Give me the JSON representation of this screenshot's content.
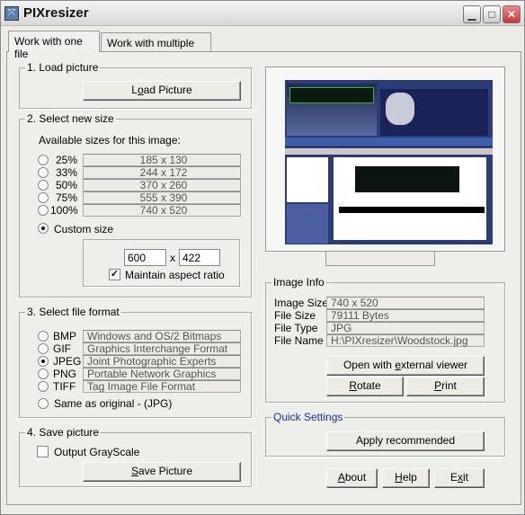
{
  "window": {
    "title": "PIXresizer",
    "controls": [
      "minimize",
      "maximize",
      "close"
    ]
  },
  "tabs": [
    {
      "label": "Work with one file",
      "active": true
    },
    {
      "label": "Work with multiple files",
      "active": false
    }
  ],
  "load": {
    "title": "1. Load picture",
    "button_pre": "L",
    "button_u": "o",
    "button_post": "ad Picture"
  },
  "size": {
    "title": "2. Select new size",
    "available_label": "Available sizes for this image:",
    "options": [
      {
        "pct": "25%",
        "dims": "185  x  130"
      },
      {
        "pct": "33%",
        "dims": "244  x  172"
      },
      {
        "pct": "50%",
        "dims": "370  x  260"
      },
      {
        "pct": "75%",
        "dims": "555  x  390"
      },
      {
        "pct": "100%",
        "dims": "740  x  520"
      }
    ],
    "custom_label": "Custom size",
    "custom_selected": true,
    "width": "600",
    "x": "x",
    "height": "422",
    "aspect_label": "Maintain aspect ratio",
    "aspect_checked": true
  },
  "format": {
    "title": "3. Select file format",
    "selected": "JPEG",
    "options": [
      {
        "code": "BMP",
        "desc": "Windows and OS/2 Bitmaps"
      },
      {
        "code": "GIF",
        "desc": "Graphics Interchange Format"
      },
      {
        "code": "JPEG",
        "desc": "Joint Photographic Experts Group"
      },
      {
        "code": "PNG",
        "desc": "Portable Network Graphics"
      },
      {
        "code": "TIFF",
        "desc": "Tag Image File Format"
      }
    ],
    "same_label": "Same as original  - (JPG)"
  },
  "save": {
    "title": "4. Save picture",
    "grayscale_label": "Output GrayScale",
    "grayscale_checked": false,
    "button_u": "S",
    "button_post": "ave Picture"
  },
  "info": {
    "title": "Image Info",
    "rows": [
      {
        "label": "Image Size",
        "value": "740 x 520"
      },
      {
        "label": "File Size",
        "value": "79111 Bytes"
      },
      {
        "label": "File Type",
        "value": "JPG"
      },
      {
        "label": "File Name",
        "value": "H:\\PIXresizer\\Woodstock.jpg"
      }
    ],
    "open_pre": "Open with ",
    "open_u": "e",
    "open_post": "xternal viewer",
    "rotate_u": "R",
    "rotate_post": "otate",
    "print_u": "P",
    "print_post": "rint"
  },
  "quick": {
    "title": "Quick Settings",
    "apply": "Apply recommended",
    "title_color": "#1a2ea0"
  },
  "footer": {
    "about_u": "A",
    "about_post": "bout",
    "help_u": "H",
    "help_post": "elp",
    "exit_pre": "E",
    "exit_u": "x",
    "exit_post": "it"
  }
}
